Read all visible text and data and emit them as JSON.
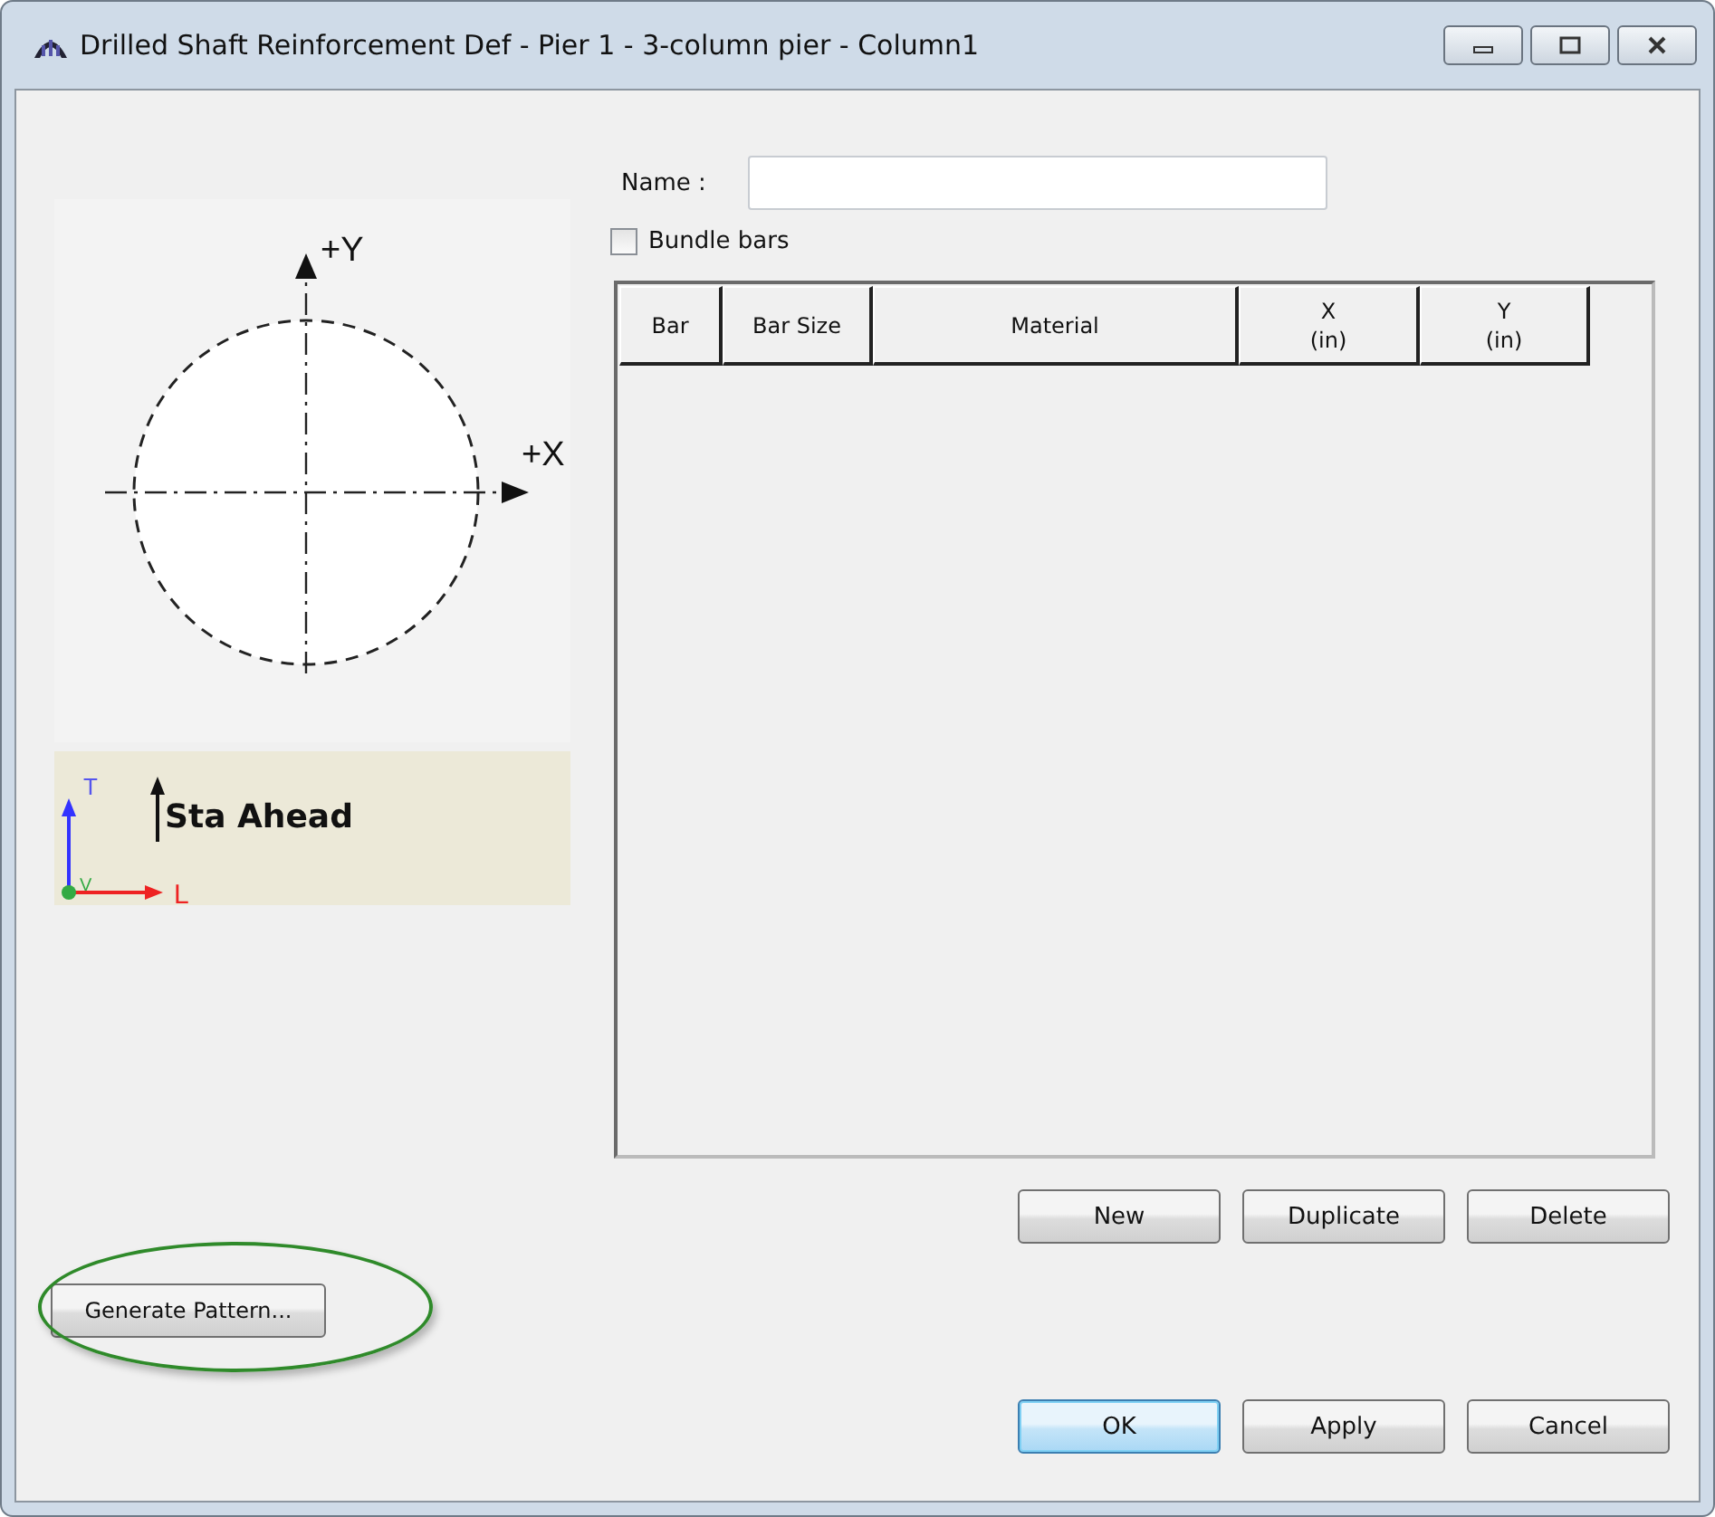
{
  "window": {
    "title": "Drilled Shaft Reinforcement Def - Pier 1 - 3-column pier - Column1"
  },
  "diagram": {
    "y_axis_label": "+Y",
    "x_axis_label": "+X"
  },
  "legend": {
    "t_label": "T",
    "v_label": "V",
    "l_label": "L",
    "direction_label": "Sta Ahead"
  },
  "name_field": {
    "label": "Name :"
  },
  "bundle_bars": {
    "label": "Bundle bars",
    "checked": false
  },
  "table": {
    "columns": [
      {
        "title": "Bar"
      },
      {
        "title": "Bar Size"
      },
      {
        "title": "Material"
      },
      {
        "title": "X",
        "unit": "(in)"
      },
      {
        "title": "Y",
        "unit": "(in)"
      }
    ]
  },
  "row_buttons": [
    {
      "label": "New"
    },
    {
      "label": "Duplicate"
    },
    {
      "label": "Delete"
    }
  ],
  "generate_button": {
    "label": "Generate Pattern...",
    "highlighted": true
  },
  "dialog_buttons": [
    {
      "label": "OK",
      "default": true
    },
    {
      "label": "Apply",
      "default": false
    },
    {
      "label": "Cancel",
      "default": false
    }
  ]
}
